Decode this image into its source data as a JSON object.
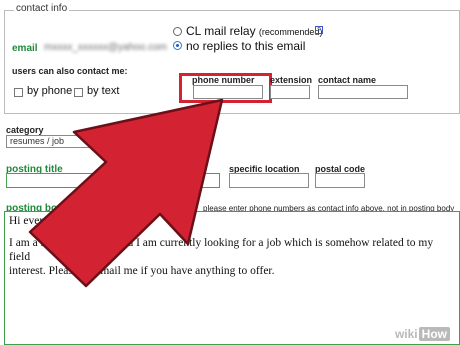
{
  "contact_info": {
    "legend": "contact info",
    "email_label": "email",
    "email_value": "mxxxx_xxxxxx@yahoo.com",
    "relay_option": "CL mail relay",
    "relay_note": "(recommended)",
    "no_replies_option": "no replies to this email",
    "help_glyph": "?",
    "also_contact_label": "users can also contact me:",
    "by_phone_label": "by phone",
    "by_text_label": "by text",
    "phone_number_label": "phone number",
    "extension_label": "extension",
    "contact_name_label": "contact name"
  },
  "category": {
    "label": "category",
    "value": "resumes / job"
  },
  "posting": {
    "title_label": "posting title",
    "specific_location_label": "specific location",
    "postal_code_label": "postal code",
    "body_label": "posting body",
    "phone_hint": "please enter phone numbers as contact info above, not in posting body",
    "body_lines": [
      "Hi every",
      "I am a registered nurse and I am currently looking for a job which is somehow related to my field",
      "interest. Please do email me if you have anything to offer."
    ]
  },
  "watermark": {
    "wiki": "wiki",
    "how": "How"
  },
  "colors": {
    "arrow": "#d32231",
    "field_green": "#41a54f",
    "label_green": "#1f8a3a"
  }
}
